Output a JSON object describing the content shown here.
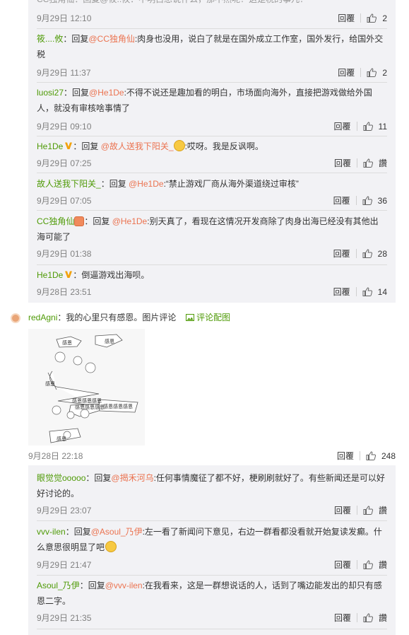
{
  "thread_top": {
    "partial_line": "CC独角仙：回复@筱..攸：不明白想说什么，那不然呢？这是税的事儿？",
    "time": "9月29日 12:10",
    "reply_label": "回覆",
    "likes": "2"
  },
  "replies_a": [
    {
      "user": "筱....攸",
      "prefix": "：回复",
      "mention": "@CC独角仙",
      "text_l1": ":肉身也没用，说白了就是在国外成立工作室，国外发行，给国外交",
      "text_l2": "税",
      "time": "9月29日 11:37",
      "reply_label": "回覆",
      "likes": "2"
    },
    {
      "user": "luosi27",
      "prefix": "：回复",
      "mention": "@He1De",
      "text_l1": ":不得不说还是趣加看的明白，市场面向海外，直接把游戏做给外国",
      "text_l2": "人，就没有审核啥事情了",
      "time": "9月29日 09:10",
      "reply_label": "回覆",
      "likes": "11"
    },
    {
      "user": "He1De",
      "prefix": "：回复 ",
      "mention": "@故人送我下阳关_",
      "text_l1": ":哎呀。我是反讽啊。",
      "text_l2": "",
      "time": "9月29日 07:25",
      "reply_label": "回覆",
      "likes": "讚"
    },
    {
      "user": "故人送我下阳关_",
      "prefix": "：回复 ",
      "mention": "@He1De",
      "text_l1": ":“禁止游戏厂商从海外渠道绕过审核”",
      "text_l2": "",
      "time": "9月29日 07:05",
      "reply_label": "回覆",
      "likes": "36"
    },
    {
      "user": "CC独角仙",
      "prefix": "：回复 ",
      "mention": "@He1De",
      "text_l1": ":别天真了，看现在这情况开发商除了肉身出海已经没有其他出",
      "text_l2": "海可能了",
      "time": "9月29日 01:38",
      "reply_label": "回覆",
      "likes": "28"
    },
    {
      "user": "He1De",
      "prefix": "：",
      "mention": "",
      "text_l1": "倒逼游戏出海呗。",
      "text_l2": "",
      "time": "9月28日 23:51",
      "reply_label": "回覆",
      "likes": "14"
    }
  ],
  "main_comment": {
    "user": "redAgni",
    "text": "：我的心里只有感恩。图片评论",
    "pic_link": "评论配图",
    "time": "9月28日 22:18",
    "reply_label": "回覆",
    "likes": "248",
    "comic_words": [
      "感恩",
      "感恩",
      "感恩",
      "感恩感恩感恩",
      "感恩感恩感恩",
      "感恩感恩感恩",
      "感恩"
    ]
  },
  "replies_b": [
    {
      "user": "眼觉觉ooooo",
      "prefix": "：回复",
      "mention": "@揭禾河乌",
      "text_l1": ":任何事情魔征了都不好，梗刷刷就好了。有些新闻还是可以好",
      "text_l2": "好讨论的。",
      "time": "9月29日 23:07",
      "reply_label": "回覆",
      "likes": "讚"
    },
    {
      "user": "vvv-ilen",
      "prefix": "：回复",
      "mention": "@Asoul_乃伊",
      "text_l1": ":左一看了新闻问下意见，右边一群看都没看就开始复读发癫。什",
      "text_l2": "么意思很明显了吧",
      "time": "9月29日 21:47",
      "reply_label": "回覆",
      "likes": "讚"
    },
    {
      "user": "Asoul_乃伊",
      "prefix": "：回复",
      "mention": "@vvv-ilen",
      "text_l1": ":在我看来，这是一群想说话的人，话到了嘴边能发出的却只有感",
      "text_l2": "恩二字。",
      "time": "9月29日 21:35",
      "reply_label": "回覆",
      "likes": "讚"
    }
  ]
}
